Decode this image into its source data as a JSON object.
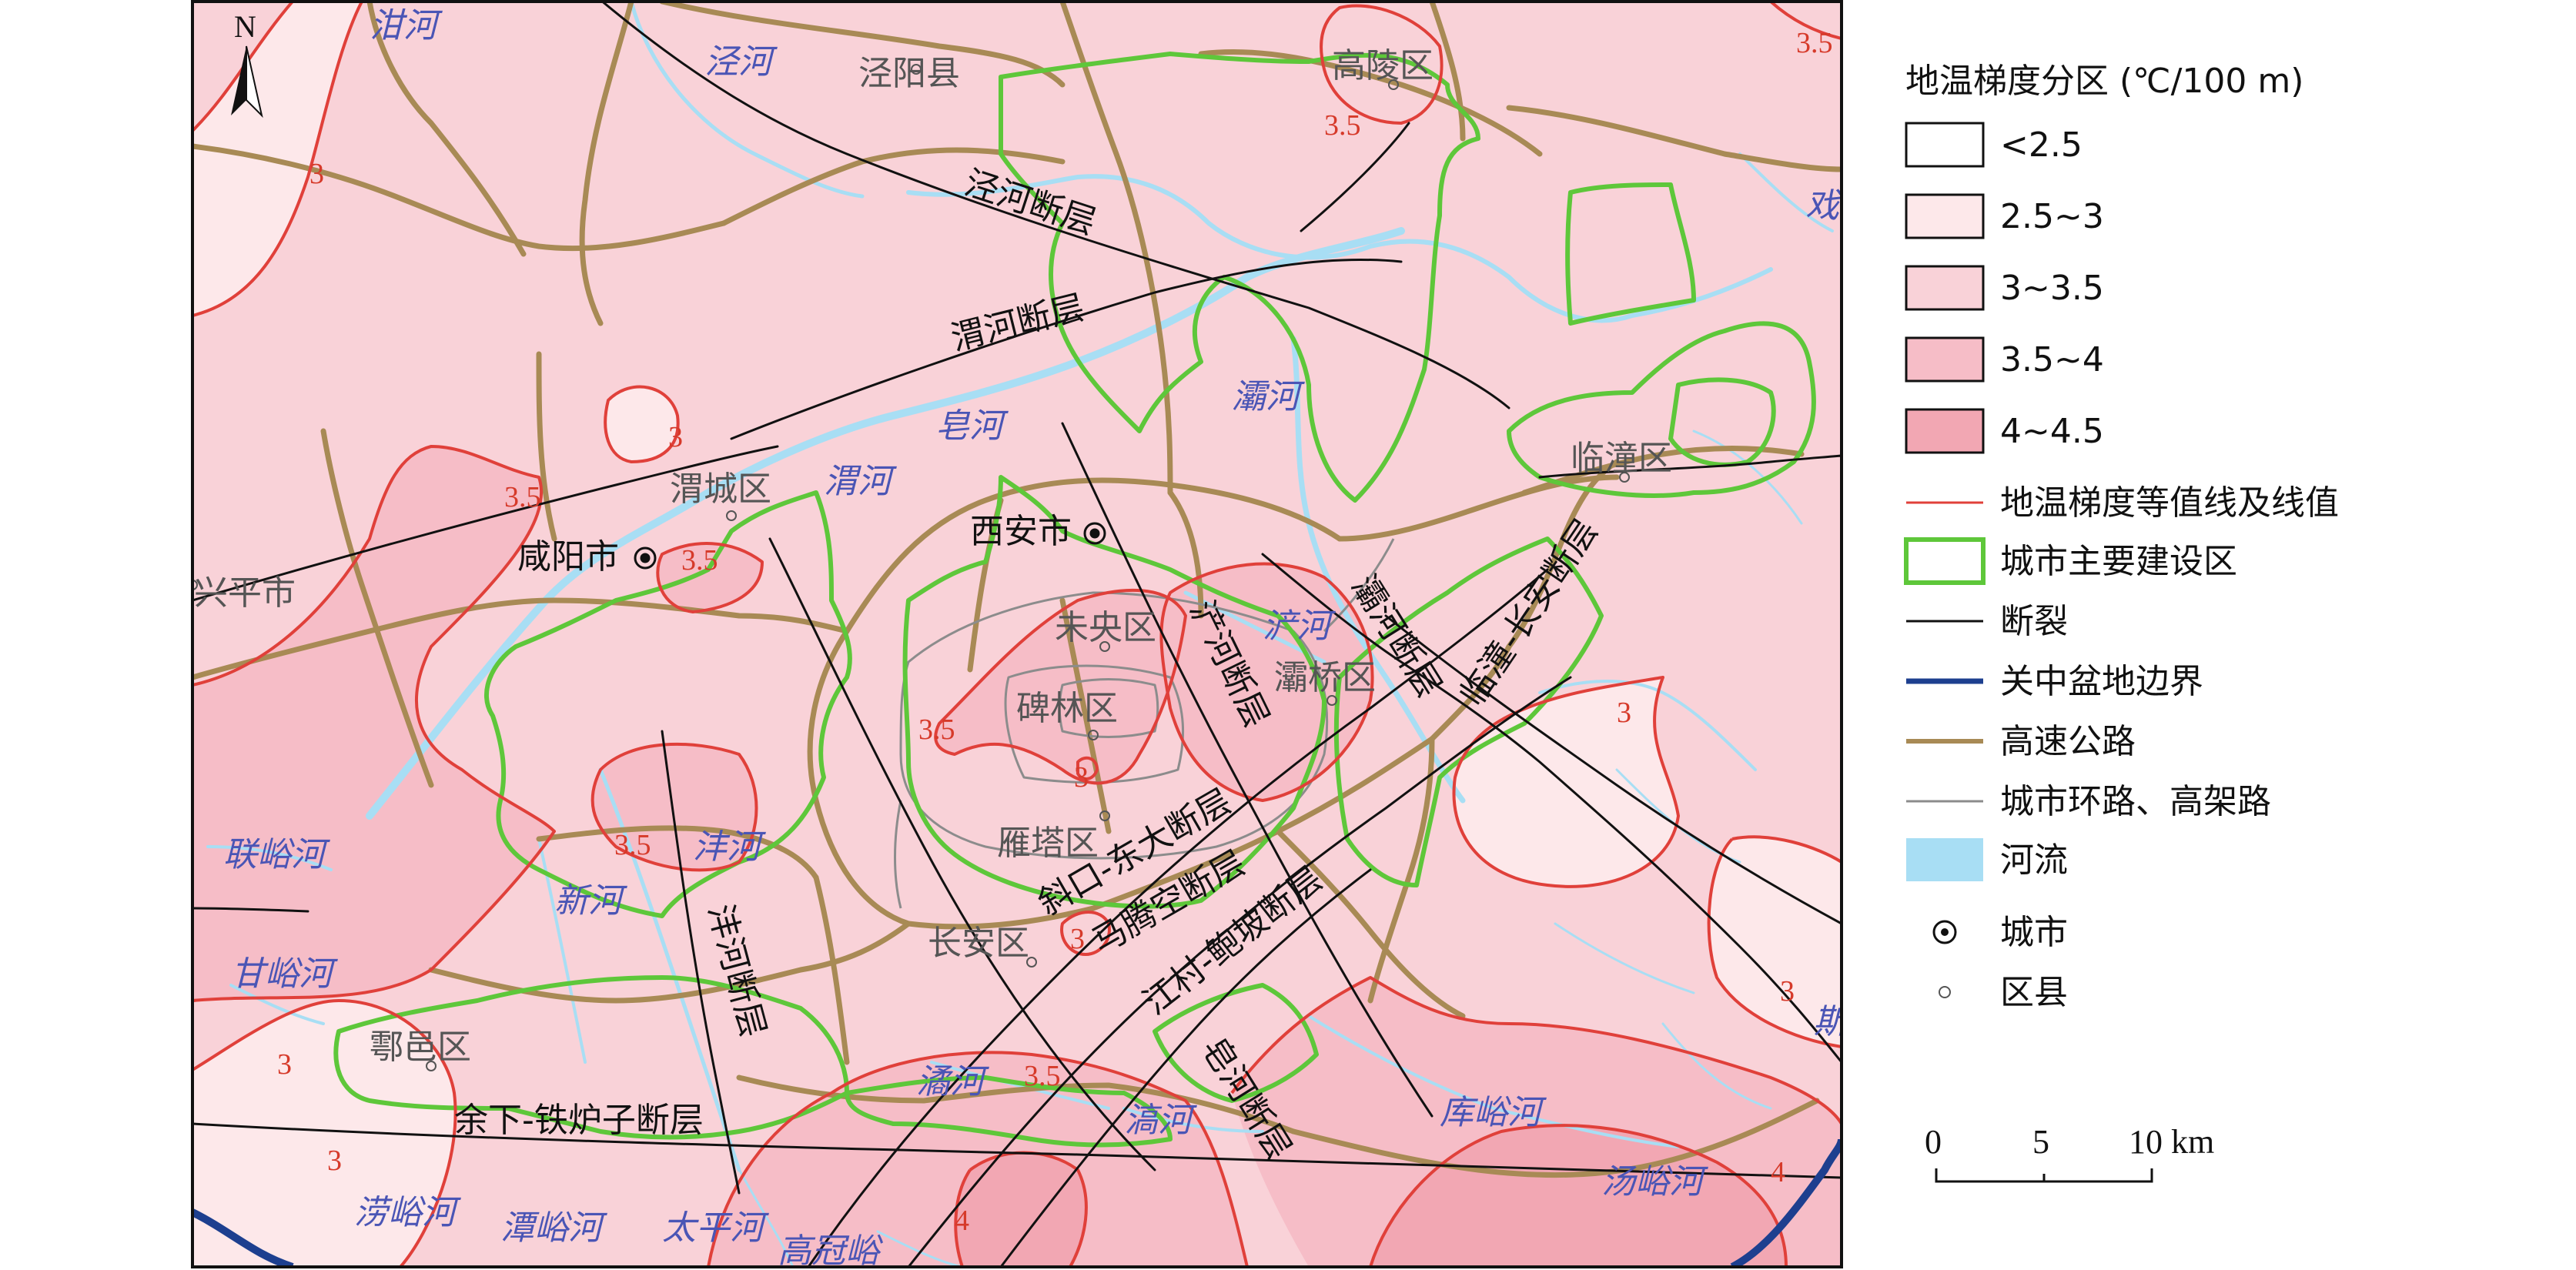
{
  "colors": {
    "lt_2_5": "#ffffff",
    "c2_5_3": "#fde8ea",
    "c3_3_5": "#f9d2d8",
    "c3_5_4": "#f6bdc7",
    "c4_4_5": "#f2a7b3",
    "isoline": "#e0403a",
    "builtup": "#5ec73a",
    "fault": "#111111",
    "basin": "#1d3f8f",
    "highway": "#a88a55",
    "ringroad": "#8c8c8c",
    "river": "#a8def4"
  },
  "north": {
    "label": "N"
  },
  "places": {
    "jingyang": "泾阳县",
    "gaoling": "高陵区",
    "weicheng": "渭城区",
    "xianyang": "咸阳市",
    "xian": "西安市",
    "xingping": "兴平市",
    "weiyang": "未央区",
    "beilin": "碑林区",
    "baqiao": "灞桥区",
    "lintong": "临潼区",
    "yanta": "雁塔区",
    "changan": "长安区",
    "huyi": "鄠邑区"
  },
  "rivers": {
    "ganhe": "泔河",
    "jinghe": "泾河",
    "weihe": "渭河",
    "zaohe": "皂河",
    "bahe": "灞河",
    "chanhe": "浐河",
    "fengyuhe": "沣河",
    "xinhe": "新河",
    "lianyuhe": "联峪河",
    "ganyuhe": "甘峪河",
    "laoyuhe": "涝峪河",
    "tanyuhe": "潭峪河",
    "taipinghe": "太平河",
    "gaoguanyu": "高冠峪",
    "jiaohe": "滈河",
    "yuhe_a": "潏河",
    "kuyuhe": "库峪河",
    "tangyuhe": "汤峪河",
    "xihe": "戏",
    "sohe": "斯"
  },
  "faults": {
    "jinghe": "泾河断层",
    "weihe": "渭河断层",
    "chanhe": "浐河断层",
    "bahe": "灞河断层",
    "lintong_chang": "临潼-长安断层",
    "xiekou": "斜口-东大断层",
    "mateng": "马腾空断层",
    "jiangcun": "江村-鲍坡断层",
    "fenghe": "沣河断层",
    "yuxia": "余下-铁炉子断层",
    "zaohe": "皂河断层"
  },
  "isolines": {
    "v3": "3",
    "v3_5": "3.5",
    "v4": "4"
  },
  "legend": {
    "title": "地温梯度分区 (℃/100 m)",
    "items": [
      {
        "label": "<2.5",
        "kind": "box",
        "color": "#ffffff"
      },
      {
        "label": "2.5~3",
        "kind": "box",
        "color": "#fde8ea"
      },
      {
        "label": "3~3.5",
        "kind": "box",
        "color": "#f9d2d8"
      },
      {
        "label": "3.5~4",
        "kind": "box",
        "color": "#f6bdc7"
      },
      {
        "label": "4~4.5",
        "kind": "box",
        "color": "#f2a7b3"
      },
      {
        "label": "地温梯度等值线及线值",
        "kind": "line",
        "color": "#e0403a"
      },
      {
        "label": "城市主要建设区",
        "kind": "greenbox",
        "color": "#5ec73a"
      },
      {
        "label": "断裂",
        "kind": "line",
        "color": "#111111"
      },
      {
        "label": "关中盆地边界",
        "kind": "line",
        "color": "#1d3f8f"
      },
      {
        "label": "高速公路",
        "kind": "line",
        "color": "#a88a55"
      },
      {
        "label": "城市环路、高架路",
        "kind": "line",
        "color": "#8c8c8c"
      },
      {
        "label": "河流",
        "kind": "river",
        "color": "#a8def4"
      },
      {
        "label": "城市",
        "kind": "city"
      },
      {
        "label": "区县",
        "kind": "county"
      }
    ]
  },
  "scale": {
    "t0": "0",
    "t1": "5",
    "t2": "10 km"
  }
}
